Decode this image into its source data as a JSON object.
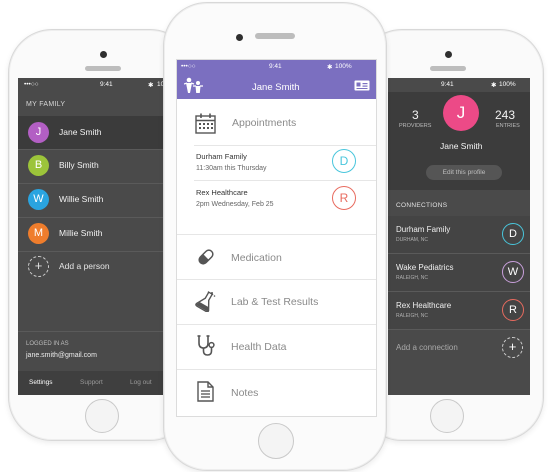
{
  "left_phone": {
    "status": {
      "signal": "•••○○",
      "time": "9:41",
      "battery": "10"
    },
    "section_title": "MY FAMILY",
    "members": [
      {
        "initial": "J",
        "name": "Jane Smith",
        "color": "#b35fc4",
        "selected": true
      },
      {
        "initial": "B",
        "name": "Billy Smith",
        "color": "#9cc43a",
        "selected": false
      },
      {
        "initial": "W",
        "name": "Willie Smith",
        "color": "#2aa4e0",
        "selected": false
      },
      {
        "initial": "M",
        "name": "Millie Smith",
        "color": "#ef7d2c",
        "selected": false
      }
    ],
    "add_person": {
      "icon": "+",
      "label": "Add a person"
    },
    "logged_in_label": "LOGGED IN AS",
    "email": "jane.smith@gmail.com",
    "bottom_tabs": [
      "Settings",
      "Support",
      "Log out"
    ]
  },
  "center_phone": {
    "status": {
      "signal": "•••○○",
      "time": "9:41",
      "battery": "100%"
    },
    "header_title": "Jane Smith",
    "header_color": "#7b6fc0",
    "appointments_label": "Appointments",
    "appointments": [
      {
        "place": "Durham Family",
        "when": "11:30am this Thursday",
        "initial": "D",
        "color": "#49c6dc"
      },
      {
        "place": "Rex Healthcare",
        "when": "2pm Wednesday, Feb 25",
        "initial": "R",
        "color": "#e86b5f"
      }
    ],
    "menu": [
      {
        "icon": "pill-icon",
        "label": "Medication"
      },
      {
        "icon": "flask-icon",
        "label": "Lab & Test Results"
      },
      {
        "icon": "stethoscope-icon",
        "label": "Health Data"
      },
      {
        "icon": "document-icon",
        "label": "Notes"
      }
    ]
  },
  "right_phone": {
    "status": {
      "time": "9:41",
      "battery": "100%"
    },
    "providers_count": "3",
    "providers_label": "PROVIDERS",
    "entries_count": "243",
    "entries_label": "ENTRIES",
    "avatar_initial": "J",
    "avatar_color": "#ec4a87",
    "name": "Jane Smith",
    "edit_button": "Edit this profile",
    "connections_label": "CONNECTIONS",
    "connections": [
      {
        "name": "Durham Family",
        "location": "DURHAM, NC",
        "initial": "D",
        "color": "#49c6dc"
      },
      {
        "name": "Wake Pediatrics",
        "location": "RALEIGH, NC",
        "initial": "W",
        "color": "#c9a0dc"
      },
      {
        "name": "Rex Healthcare",
        "location": "RALEIGH, NC",
        "initial": "R",
        "color": "#e86b5f"
      }
    ],
    "add_connection": {
      "label": "Add a connection",
      "icon": "+"
    }
  }
}
